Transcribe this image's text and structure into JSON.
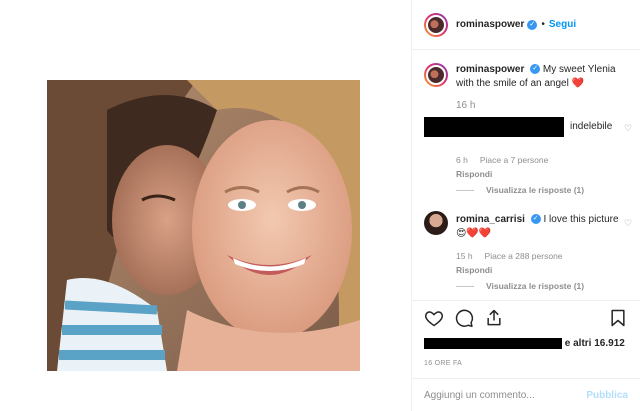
{
  "post": {
    "author": "rominaspower",
    "follow_label": "Segui",
    "separator": "•",
    "caption_text": "My sweet Ylenia with the smile of an angel",
    "caption_emoji": "❤️",
    "caption_time": "16 h"
  },
  "comments": [
    {
      "text_partial": "indelebile",
      "time": "6 h",
      "likes": "Piace a 7 persone",
      "reply": "Rispondi",
      "view_replies": "Visualizza le risposte (1)"
    },
    {
      "author": "romina_carrisi",
      "text": "I love this picture",
      "emoji": "😍❤️❤️",
      "time": "15 h",
      "likes": "Piace a 288 persone",
      "reply": "Rispondi",
      "view_replies": "Visualizza le risposte (1)"
    }
  ],
  "footer": {
    "likes_suffix": "e altri 16.912",
    "time_ago": "16 ORE FA",
    "comment_placeholder": "Aggiungi un commento...",
    "publish_label": "Pubblica"
  },
  "icons": [
    "heart-icon",
    "comment-icon",
    "share-icon",
    "bookmark-icon",
    "verified-badge-icon",
    "small-heart-icon"
  ],
  "colors": {
    "link": "#0095f6",
    "verified": "#3897f0",
    "heart": "#ed4956",
    "muted": "#8e8e8e"
  }
}
